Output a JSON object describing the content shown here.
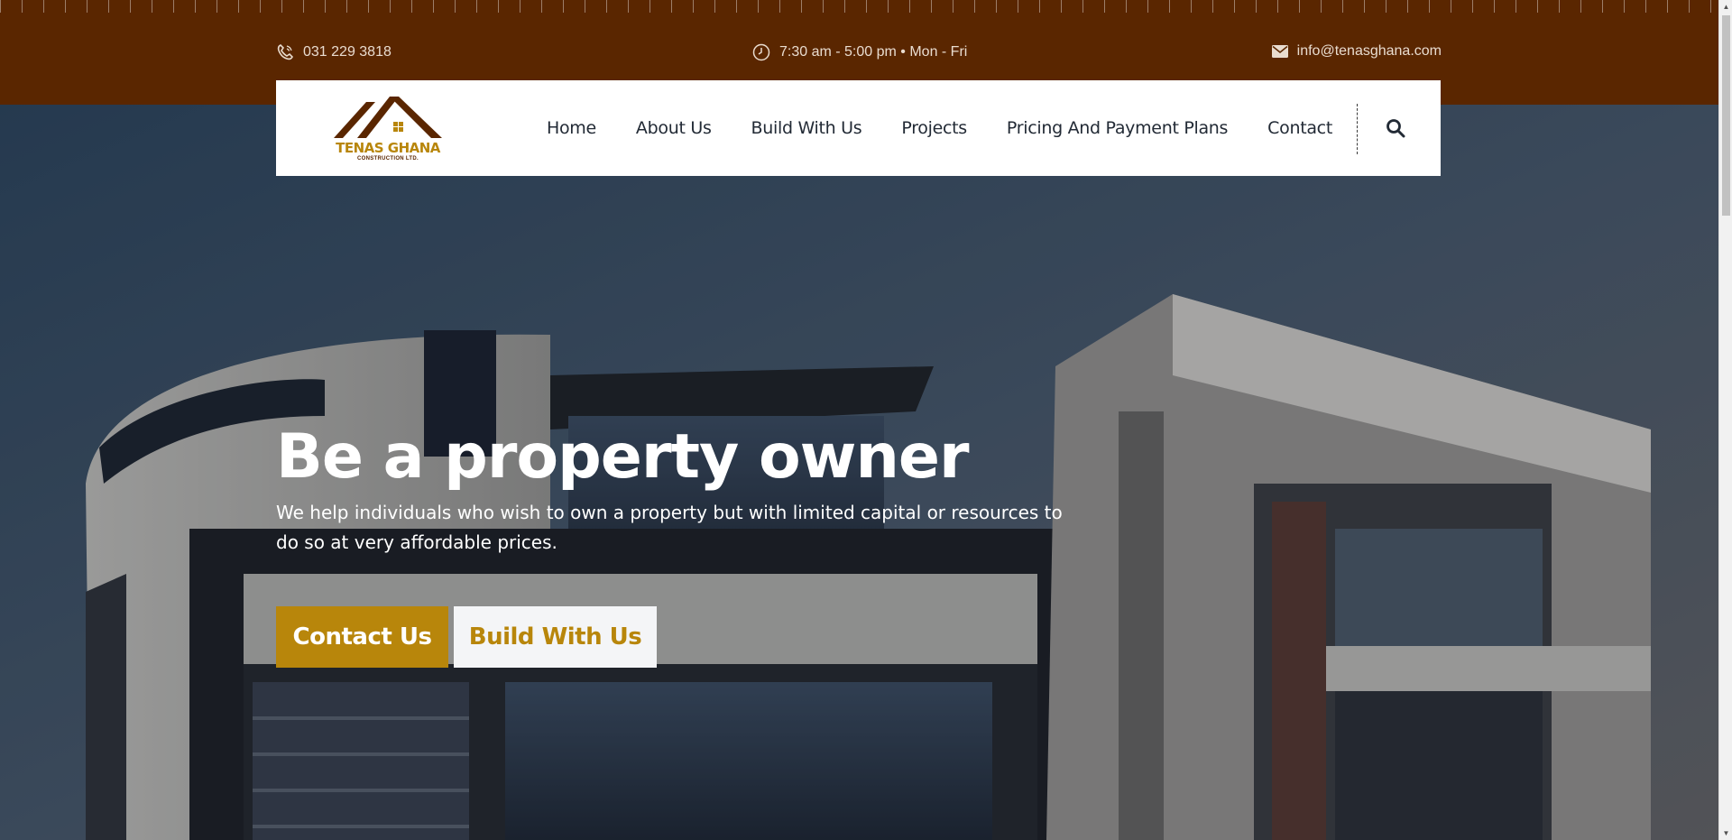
{
  "topbar": {
    "phone": "031 229 3818",
    "hours": "7:30 am - 5:00 pm • Mon - Fri",
    "email": "info@tenasghana.com",
    "icons": {
      "phone": "phone-icon",
      "hours": "clock-icon",
      "email": "envelope-icon"
    }
  },
  "brand": {
    "name": "TENAS GHANA",
    "sub": "CONSTRUCTION LTD.",
    "colors": {
      "primary": "#5a2600",
      "accent": "#b8860b"
    }
  },
  "nav": {
    "items": [
      {
        "label": "Home"
      },
      {
        "label": "About Us"
      },
      {
        "label": "Build With Us"
      },
      {
        "label": "Projects"
      },
      {
        "label": "Pricing And Payment Plans"
      },
      {
        "label": "Contact"
      }
    ],
    "search_icon": "search-icon"
  },
  "hero": {
    "title": "Be a property owner",
    "subtitle": "We help individuals who wish to own a property but with limited capital or resources to do so at very affordable prices.",
    "buttons": {
      "contact": "Contact Us",
      "build": "Build With Us"
    }
  },
  "colors": {
    "topbar_bg": "#5a2600",
    "accent": "#b8860b",
    "nav_text": "#222a35"
  }
}
